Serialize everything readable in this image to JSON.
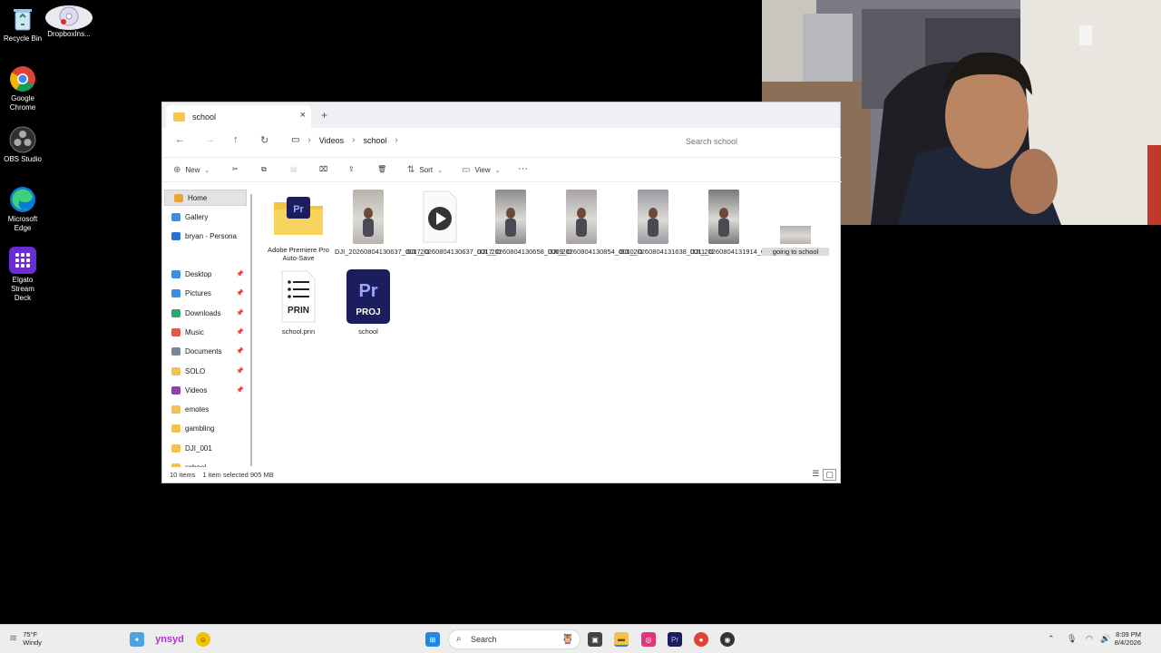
{
  "desktop": {
    "icons": [
      {
        "label": "Recycle Bin",
        "icon": "recycle-bin-icon"
      },
      {
        "label": "DropboxIns...",
        "icon": "dropbox-installer-icon"
      },
      {
        "label": "Google Chrome",
        "icon": "chrome-icon"
      },
      {
        "label": "OBS Studio",
        "icon": "obs-icon"
      },
      {
        "label": "Microsoft Edge",
        "icon": "edge-icon"
      },
      {
        "label": "Elgato Stream Deck",
        "icon": "stream-deck-icon"
      }
    ]
  },
  "explorer": {
    "tab_title": "school",
    "new_tab": "+",
    "breadcrumbs": [
      "Videos",
      "school"
    ],
    "search_placeholder": "Search school",
    "commands": {
      "new": "New",
      "sort": "Sort",
      "view": "View",
      "more": "···"
    },
    "nav": [
      {
        "label": "Home",
        "icon": "home-icon",
        "color": "#e8a33b",
        "pinned": false
      },
      {
        "label": "Gallery",
        "icon": "gallery-icon",
        "color": "#3a8ee6",
        "pinned": false
      },
      {
        "label": "bryan - Persona",
        "icon": "onedrive-icon",
        "color": "#2b6fd6",
        "pinned": false
      },
      {
        "label": "Desktop",
        "icon": "desktop-icon",
        "color": "#3a8ee6",
        "pinned": true
      },
      {
        "label": "Pictures",
        "icon": "pictures-icon",
        "color": "#3a8ee6",
        "pinned": true
      },
      {
        "label": "Downloads",
        "icon": "downloads-icon",
        "color": "#2aa86a",
        "pinned": true
      },
      {
        "label": "Music",
        "icon": "music-icon",
        "color": "#e2574c",
        "pinned": true
      },
      {
        "label": "Documents",
        "icon": "documents-icon",
        "color": "#7b8794",
        "pinned": true
      },
      {
        "label": "SOLO",
        "icon": "folder-icon",
        "color": "#f2c14e",
        "pinned": true
      },
      {
        "label": "Videos",
        "icon": "videos-icon",
        "color": "#8e44ad",
        "pinned": true
      },
      {
        "label": "emotes",
        "icon": "folder-icon",
        "color": "#f2c14e",
        "pinned": false
      },
      {
        "label": "gambling",
        "icon": "folder-icon",
        "color": "#f2c14e",
        "pinned": false
      },
      {
        "label": "DJI_001",
        "icon": "folder-icon",
        "color": "#f2c14e",
        "pinned": false
      },
      {
        "label": "school",
        "icon": "folder-icon",
        "color": "#f2c14e",
        "pinned": false
      }
    ],
    "files": [
      {
        "name": "Adobe Premiere Pro Auto-Save",
        "kind": "folder"
      },
      {
        "name": "DJI_20260804130637_0017_D",
        "kind": "video"
      },
      {
        "name": "DJI_20260804130637_0017_D",
        "kind": "audio"
      },
      {
        "name": "DJI_20260804130658_0009_D",
        "kind": "video"
      },
      {
        "name": "DJI_20260804130854_0010_D",
        "kind": "video"
      },
      {
        "name": "DJI_20260804131638_0011_D",
        "kind": "video"
      },
      {
        "name": "DJI_20260804131914_0012_D",
        "kind": "video"
      },
      {
        "name": "going to school",
        "kind": "video",
        "selected": true
      },
      {
        "name": "school.prin",
        "kind": "prin",
        "badge": "PRIN"
      },
      {
        "name": "school",
        "kind": "proj",
        "badge": "PROJ",
        "logo": "Pr"
      }
    ],
    "status": {
      "count": "10 items",
      "selection": "1 item selected  905 MB"
    }
  },
  "taskbar": {
    "weather_temp": "75°F",
    "weather_desc": "Windy",
    "search": "Search",
    "time": "8:09 PM",
    "date": "8/4/2026"
  }
}
